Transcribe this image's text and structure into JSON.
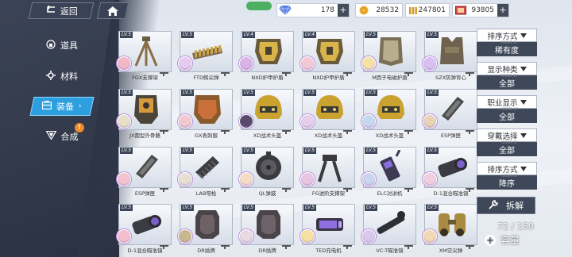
{
  "topbar": {
    "back_label": "返回",
    "diamond": "178",
    "coin": "28532",
    "ammo": "247801",
    "ticket": "93805"
  },
  "sidebar": {
    "items": [
      {
        "label": "道具",
        "icon": "bag-icon"
      },
      {
        "label": "材料",
        "icon": "gear-icon"
      },
      {
        "label": "装备",
        "icon": "box-icon",
        "active": true
      },
      {
        "label": "合成",
        "icon": "triangle-icon",
        "badge": "!"
      }
    ]
  },
  "items": [
    {
      "lv": "LV.5",
      "name": "FGX支撑架",
      "art": "tripod",
      "avatar": "#f2b8c8"
    },
    {
      "lv": "LV.5",
      "name": "FTD鳄尖弹",
      "art": "belt",
      "avatar": "#e8c9f0"
    },
    {
      "lv": "LV.4",
      "name": "NXD护甲护盾",
      "art": "armor",
      "avatar": "#d7b3e8"
    },
    {
      "lv": "LV.4",
      "name": "NXD护甲护盾",
      "art": "armor",
      "avatar": "#f3c9d4"
    },
    {
      "lv": "LV.5",
      "name": "M因子电磁护盾",
      "art": "shield",
      "avatar": "#f5e1a8"
    },
    {
      "lv": "LV.5",
      "name": "SZX防弹背心",
      "art": "vest",
      "avatar": "#d9bff2"
    },
    {
      "lv": "LV.5",
      "name": "JX圆型外骨骼",
      "art": "exo",
      "avatar": "#e8dfc9"
    },
    {
      "lv": "LV.5",
      "name": "GX表刺服",
      "art": "exo2",
      "avatar": "#f0c8d0"
    },
    {
      "lv": "LV.5",
      "name": "XD战术头盔",
      "art": "helmet",
      "avatar": "#5a4a6a"
    },
    {
      "lv": "LV.5",
      "name": "XD战术头盔",
      "art": "helmet",
      "avatar": "#e6cfe8"
    },
    {
      "lv": "LV.5",
      "name": "XD战术头盔",
      "art": "helmet",
      "avatar": "#c8d8f0"
    },
    {
      "lv": "LV.5",
      "name": "ESP弹匣",
      "art": "mag",
      "avatar": "#e9d3b8"
    },
    {
      "lv": "LV.5",
      "name": "ESP弹匣",
      "art": "mag",
      "avatar": "#f2c2cf"
    },
    {
      "lv": "LV.5",
      "name": "LAB哑枪",
      "art": "silencer",
      "avatar": "#e7e0d2"
    },
    {
      "lv": "LV.5",
      "name": "QL弹鼓",
      "art": "drum",
      "avatar": "#f5dcc4"
    },
    {
      "lv": "LV.5",
      "name": "FG进阶支撑架",
      "art": "bipod",
      "avatar": "#e8c4e0"
    },
    {
      "lv": "LV.5",
      "name": "ELC对讲机",
      "art": "radio",
      "avatar": "#c9d6ee"
    },
    {
      "lv": "LV.5",
      "name": "D-1混合瞄准镜",
      "art": "scope",
      "avatar": "#f0d0de"
    },
    {
      "lv": "LV.5",
      "name": "D-1混合瞄准镜",
      "art": "scope",
      "avatar": "#f3bfcc"
    },
    {
      "lv": "LV.5",
      "name": "DR插牌",
      "art": "plate",
      "avatar": "#c8b890"
    },
    {
      "lv": "LV.5",
      "name": "DR插牌",
      "art": "plate",
      "avatar": "#e9d9e2"
    },
    {
      "lv": "LV.5",
      "name": "TED充电机",
      "art": "charger",
      "avatar": "#f6e2a0"
    },
    {
      "lv": "LV.5",
      "name": "VC-T瞄准镜",
      "art": "rifle-scope",
      "avatar": "#d9c8ec"
    },
    {
      "lv": "LV.5",
      "name": "XM空尖弹",
      "art": "binocular",
      "avatar": "#f1d9b2"
    }
  ],
  "filters": [
    {
      "title": "排序方式",
      "sub": "ORDER BY",
      "value": "稀有度"
    },
    {
      "title": "显示种类",
      "sub": "ORDER BY",
      "value": "全部"
    },
    {
      "title": "职业显示",
      "sub": "ORDER BY",
      "value": "全部"
    },
    {
      "title": "穿戴选择",
      "sub": "ORDER BY",
      "value": "全部"
    },
    {
      "title": "排序方式",
      "sub": "ORDER BY",
      "value": "降序"
    }
  ],
  "actions": {
    "dismantle": "拆解",
    "capacity_count": "72 / 150",
    "capacity": "容量"
  },
  "colors": {
    "accent": "#2d9fdf",
    "panel_dark": "#3f4859",
    "alert": "#f28a27"
  }
}
